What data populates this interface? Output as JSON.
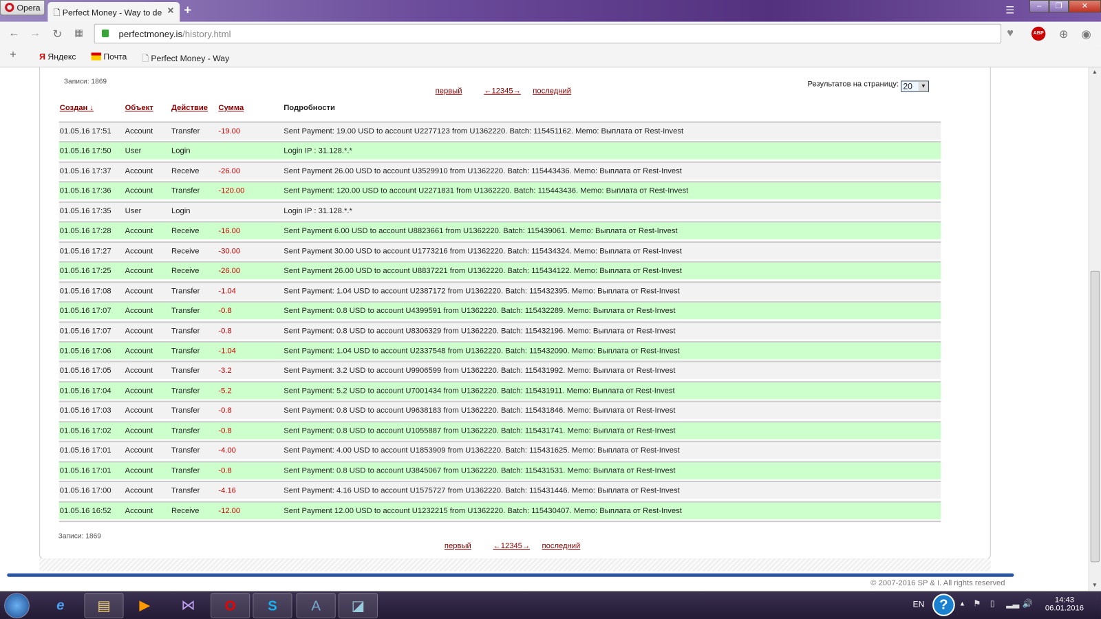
{
  "browser": {
    "opera_label": "Opera",
    "tab_title": "Perfect Money - Way to de",
    "url_host": "perfectmoney.is",
    "url_path": "/history.html",
    "bookmarks": [
      {
        "label": "Яндекс"
      },
      {
        "label": "Почта"
      },
      {
        "label": "Perfect Money - Way"
      }
    ]
  },
  "page": {
    "records_label": "Записи: 1869",
    "first_label": "первый",
    "pages_label": "←12345→",
    "last_label": "последний",
    "per_page_label": "Результатов на страницу:",
    "per_page_value": "20",
    "columns": {
      "created": "Создан ↓",
      "object": "Объект",
      "action": "Действие",
      "amount": "Сумма",
      "details": "Подробности"
    },
    "footer": "© 2007-2016 SP & I. All rights reserved"
  },
  "colors": {
    "row_odd": "#f2f2f2",
    "row_even": "#ccffcc",
    "amount": "#cc0000",
    "link": "#8b0000"
  },
  "rows": [
    {
      "date": "01.05.16 17:51",
      "object": "Account",
      "action": "Transfer",
      "amount": "-19.00",
      "details": "Sent Payment: 19.00 USD to account U2277123 from U1362220. Batch: 115451162. Memo: Выплата от Rest-Invest"
    },
    {
      "date": "01.05.16 17:50",
      "object": "User",
      "action": "Login",
      "amount": "",
      "details": "Login IP : 31.128.*.*"
    },
    {
      "date": "01.05.16 17:37",
      "object": "Account",
      "action": "Receive",
      "amount": "-26.00",
      "details": "Sent Payment 26.00 USD to account U3529910 from U1362220. Batch: 115443436.  Memo: Выплата от Rest-Invest"
    },
    {
      "date": "01.05.16 17:36",
      "object": "Account",
      "action": "Transfer",
      "amount": "-120.00",
      "details": "Sent Payment: 120.00 USD to account U2271831 from U1362220. Batch: 115443436.  Memo: Выплата от Rest-Invest"
    },
    {
      "date": "01.05.16 17:35",
      "object": "User",
      "action": "Login",
      "amount": "",
      "details": "Login IP : 31.128.*.*"
    },
    {
      "date": "01.05.16 17:28",
      "object": "Account",
      "action": "Receive",
      "amount": "-16.00",
      "details": "Sent Payment 6.00 USD to account U8823661 from U1362220. Batch: 115439061.   Memo: Выплата от Rest-Invest"
    },
    {
      "date": "01.05.16 17:27",
      "object": "Account",
      "action": "Receive",
      "amount": "-30.00",
      "details": "Sent Payment 30.00 USD to account U1773216 from U1362220. Batch: 115434324.  Memo: Выплата от Rest-Invest"
    },
    {
      "date": "01.05.16 17:25",
      "object": "Account",
      "action": "Receive",
      "amount": "-26.00",
      "details": "Sent Payment 26.00 USD to account U8837221 from U1362220. Batch: 115434122.  Memo: Выплата от Rest-Invest"
    },
    {
      "date": "01.05.16 17:08",
      "object": "Account",
      "action": "Transfer",
      "amount": "-1.04",
      "details": "Sent Payment: 1.04 USD to account U2387172 from U1362220. Batch: 115432395. Memo: Выплата от Rest-Invest"
    },
    {
      "date": "01.05.16 17:07",
      "object": "Account",
      "action": "Transfer",
      "amount": "-0.8",
      "details": "Sent Payment: 0.8 USD to account U4399591 from U1362220. Batch: 115432289. Memo: Выплата от Rest-Invest"
    },
    {
      "date": "01.05.16 17:07",
      "object": "Account",
      "action": "Transfer",
      "amount": "-0.8",
      "details": "Sent Payment: 0.8 USD to account U8306329 from U1362220. Batch: 115432196. Memo: Выплата от Rest-Invest"
    },
    {
      "date": "01.05.16 17:06",
      "object": "Account",
      "action": "Transfer",
      "amount": "-1.04",
      "details": "Sent Payment: 1.04 USD to account U2337548 from U1362220. Batch: 115432090. Memo: Выплата от Rest-Invest"
    },
    {
      "date": "01.05.16 17:05",
      "object": "Account",
      "action": "Transfer",
      "amount": "-3.2",
      "details": "Sent Payment: 3.2 USD to account U9906599 from U1362220. Batch: 115431992. Memo: Выплата от Rest-Invest"
    },
    {
      "date": "01.05.16 17:04",
      "object": "Account",
      "action": "Transfer",
      "amount": "-5.2",
      "details": "Sent Payment: 5.2 USD to account U7001434 from U1362220. Batch: 115431911. Memo: Выплата от Rest-Invest"
    },
    {
      "date": "01.05.16 17:03",
      "object": "Account",
      "action": "Transfer",
      "amount": "-0.8",
      "details": "Sent Payment: 0.8 USD to account U9638183 from U1362220. Batch: 115431846. Memo: Выплата от Rest-Invest"
    },
    {
      "date": "01.05.16 17:02",
      "object": "Account",
      "action": "Transfer",
      "amount": "-0.8",
      "details": "Sent Payment: 0.8 USD to account U1055887 from U1362220. Batch: 115431741. Memo: Выплата от Rest-Invest"
    },
    {
      "date": "01.05.16 17:01",
      "object": "Account",
      "action": "Transfer",
      "amount": "-4.00",
      "details": "Sent Payment: 4.00 USD to account U1853909 from U1362220. Batch: 115431625. Memo: Выплата от Rest-Invest"
    },
    {
      "date": "01.05.16 17:01",
      "object": "Account",
      "action": "Transfer",
      "amount": "-0.8",
      "details": "Sent Payment: 0.8 USD to account U3845067 from U1362220. Batch: 115431531. Memo: Выплата от Rest-Invest"
    },
    {
      "date": "01.05.16 17:00",
      "object": "Account",
      "action": "Transfer",
      "amount": "-4.16",
      "details": "Sent Payment: 4.16 USD to account U1575727 from U1362220. Batch: 115431446. Memo: Выплата от Rest-Invest"
    },
    {
      "date": "01.05.16 16:52",
      "object": "Account",
      "action": "Receive",
      "amount": "-12.00",
      "details": "Sent Payment 12.00 USD to account U1232215 from U1362220. Batch: 115430407.  Memo: Выплата от Rest-Invest"
    }
  ],
  "taskbar": {
    "lang": "EN",
    "time": "14:43",
    "date": "06.01.2016"
  }
}
